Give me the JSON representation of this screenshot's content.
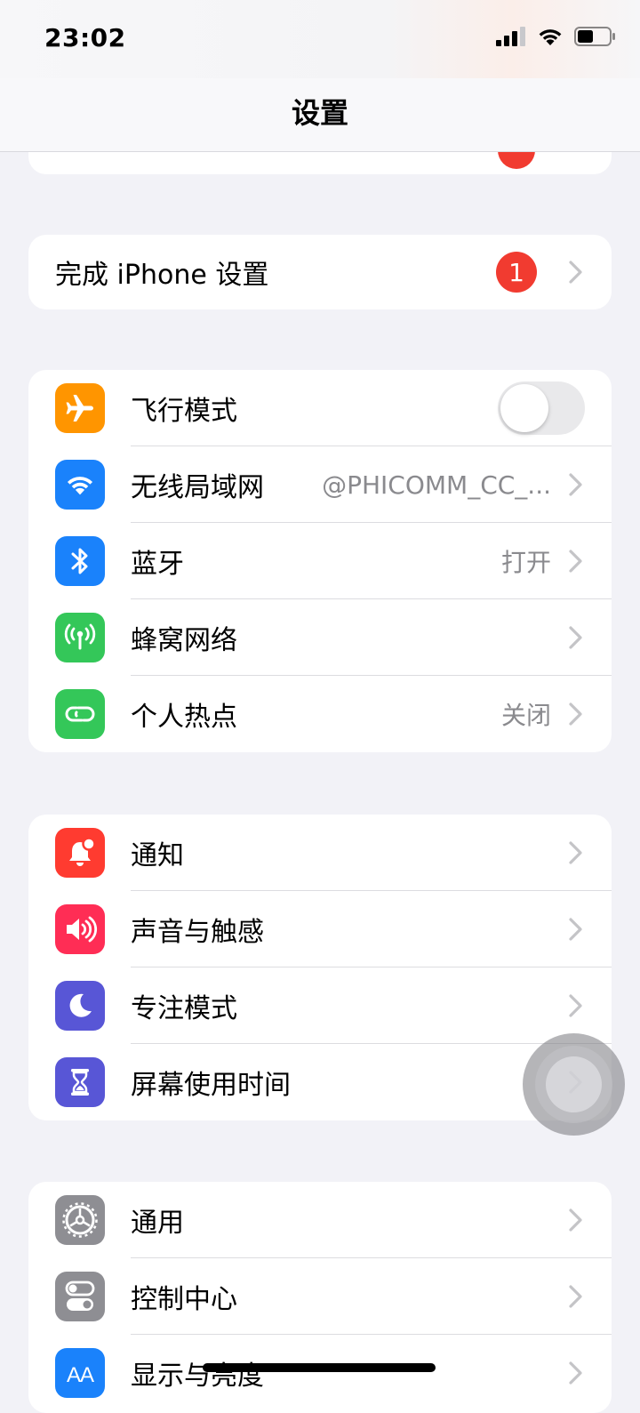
{
  "status_bar": {
    "time": "23:02"
  },
  "nav": {
    "title": "设置"
  },
  "setup": {
    "label": "完成 iPhone 设置",
    "badge": "1"
  },
  "connectivity": [
    {
      "label": "飞行模式",
      "icon": "airplane-icon",
      "color": "#ff9500",
      "value": ""
    },
    {
      "label": "无线局域网",
      "icon": "wifi-icon",
      "color": "#1a82fb",
      "value": "@PHICOMM_CC_..."
    },
    {
      "label": "蓝牙",
      "icon": "bluetooth-icon",
      "color": "#1a82fb",
      "value": "打开"
    },
    {
      "label": "蜂窝网络",
      "icon": "cellular-icon",
      "color": "#34c759",
      "value": ""
    },
    {
      "label": "个人热点",
      "icon": "hotspot-icon",
      "color": "#34c759",
      "value": "关闭"
    }
  ],
  "notifications": [
    {
      "label": "通知",
      "icon": "bell-icon",
      "color": "#ff3b30"
    },
    {
      "label": "声音与触感",
      "icon": "speaker-icon",
      "color": "#ff2d55"
    },
    {
      "label": "专注模式",
      "icon": "moon-icon",
      "color": "#5856d6"
    },
    {
      "label": "屏幕使用时间",
      "icon": "hourglass-icon",
      "color": "#5856d6"
    }
  ],
  "general": [
    {
      "label": "通用",
      "icon": "gear-icon",
      "color": "#8e8e93"
    },
    {
      "label": "控制中心",
      "icon": "toggles-icon",
      "color": "#8e8e93"
    },
    {
      "label": "显示与亮度",
      "icon": "text-size-icon",
      "color": "#1a82fb",
      "icon_text": "AA"
    }
  ]
}
